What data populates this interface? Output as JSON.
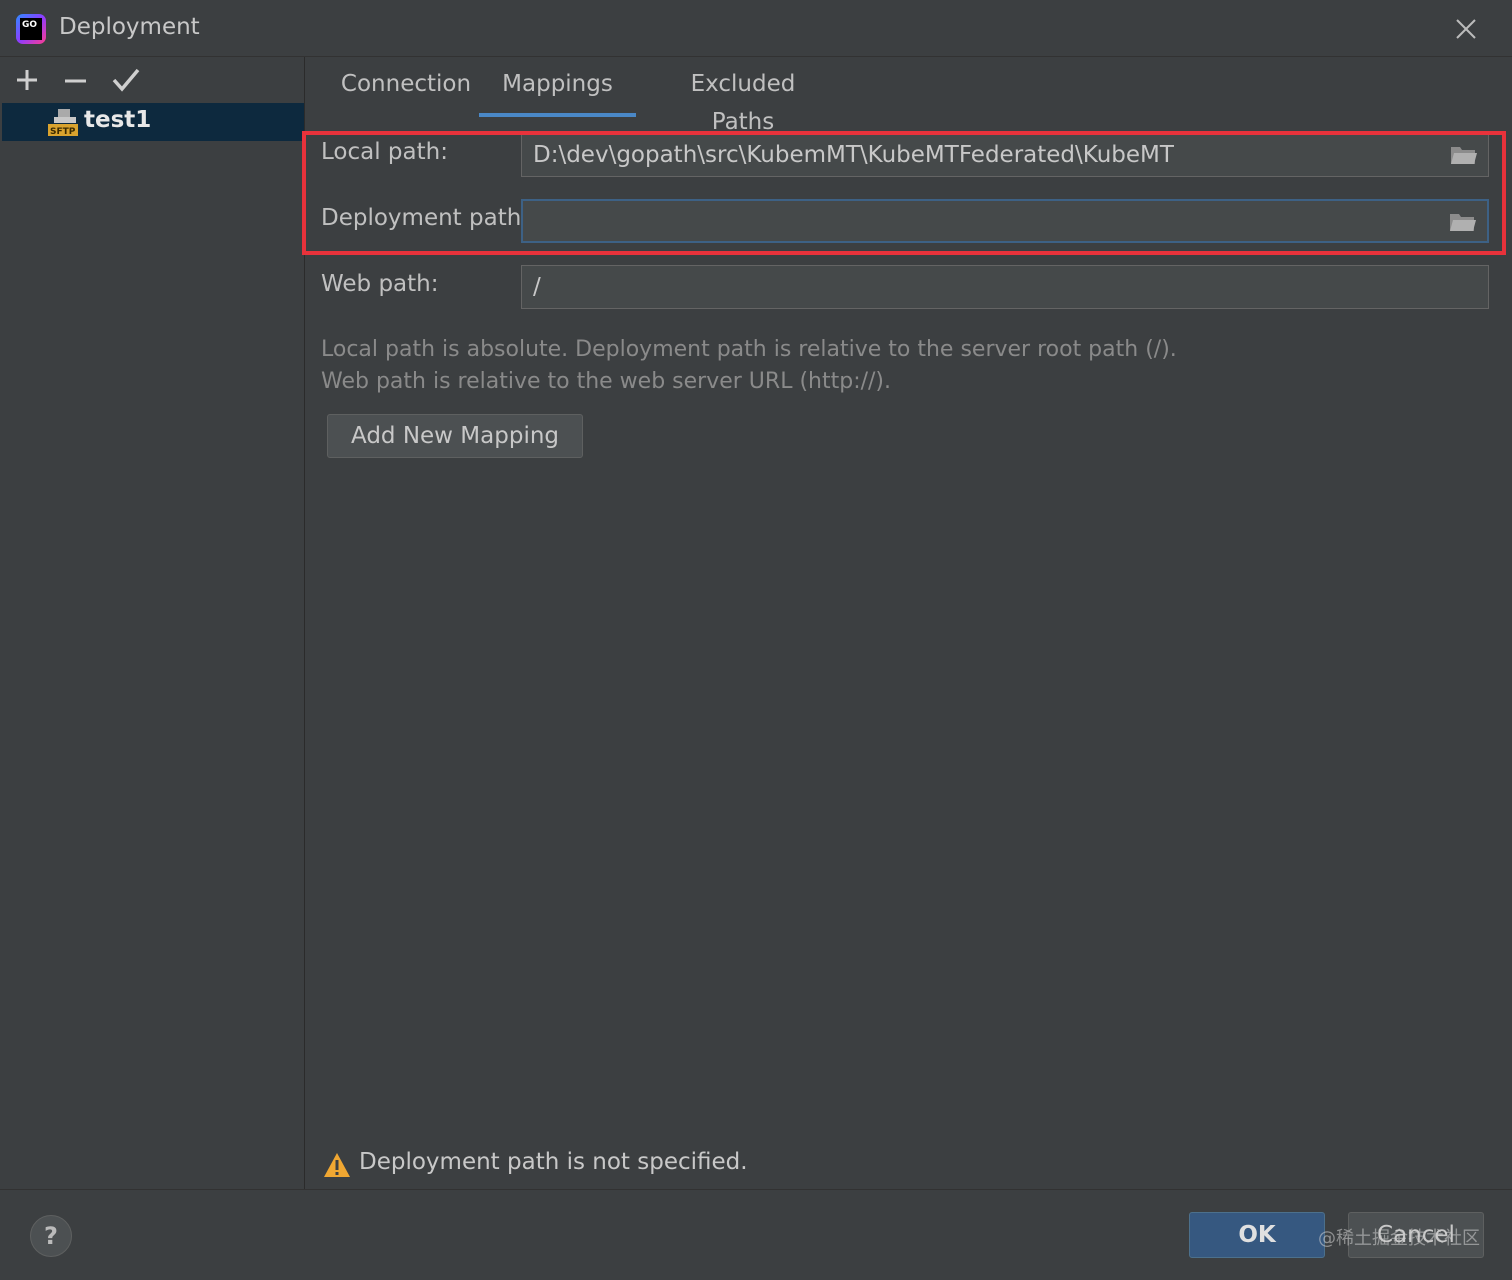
{
  "window": {
    "title": "Deployment"
  },
  "sidebar": {
    "toolbar": {
      "add_icon": "plus-icon",
      "remove_icon": "minus-icon",
      "apply_icon": "check-icon"
    },
    "servers": [
      {
        "name": "test1",
        "type_badge": "SFTP"
      }
    ]
  },
  "tabs": [
    {
      "label": "Connection",
      "active": false
    },
    {
      "label": "Mappings",
      "active": true
    },
    {
      "label": "Excluded Paths",
      "active": false
    }
  ],
  "mapping": {
    "local_path_label": "Local path:",
    "local_path_value": "D:\\dev\\gopath\\src\\KubemMT\\KubeMTFederated\\KubeMT",
    "deployment_path_label": "Deployment path:",
    "deployment_path_value": "",
    "web_path_label": "Web path:",
    "web_path_value": "/"
  },
  "hints": {
    "line1": "Local path is absolute. Deployment path is relative to the server root path (/).",
    "line2": "Web path is relative to the web server URL (http://)."
  },
  "add_mapping_label": "Add New Mapping",
  "warning": "Deployment path is not specified.",
  "footer": {
    "help_label": "?",
    "ok_label": "OK",
    "cancel_label": "Cancel"
  },
  "watermark": "@稀土掘金技术社区",
  "colors": {
    "accent": "#4a88c7",
    "highlight": "#e8323b",
    "ok_button": "#365880",
    "warning": "#f0a732"
  }
}
